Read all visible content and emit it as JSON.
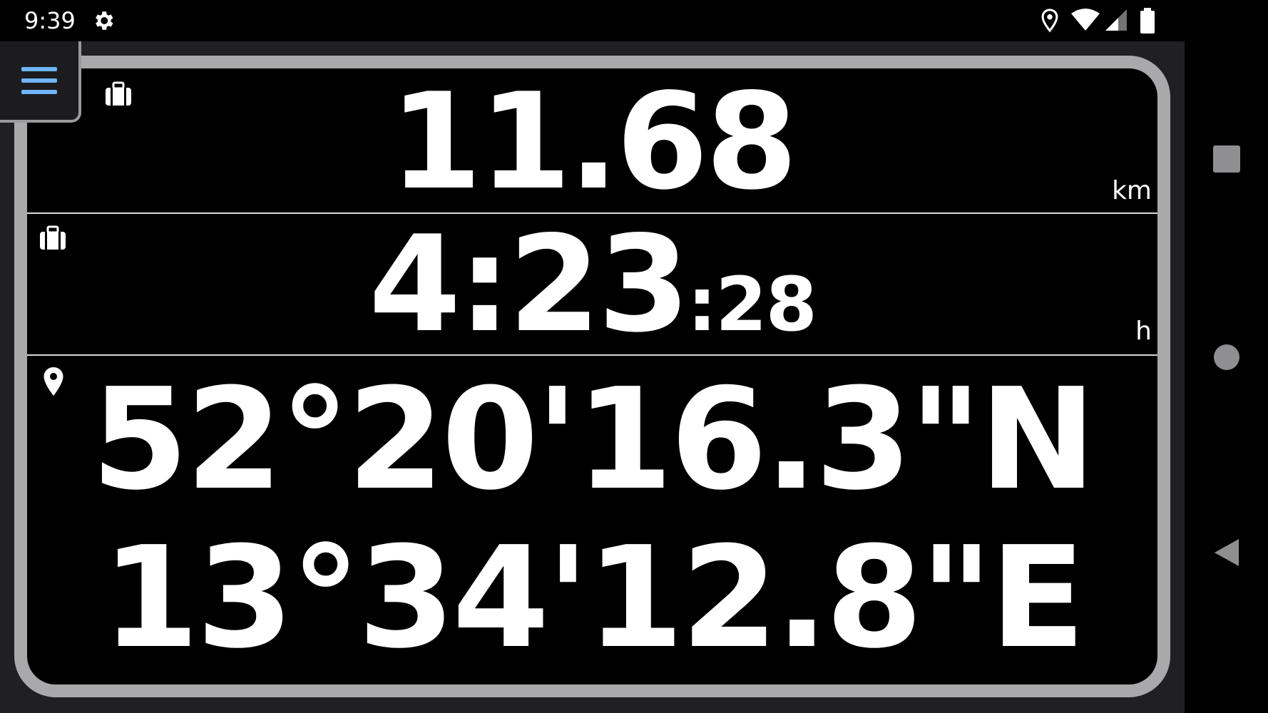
{
  "status_bar": {
    "time": "9:39",
    "icons": [
      "gear-icon",
      "location-icon",
      "wifi-icon",
      "signal-icon",
      "battery-icon"
    ]
  },
  "nav_bar": {
    "icons": [
      "square-icon",
      "circle-icon",
      "back-triangle-icon"
    ]
  },
  "colors": {
    "frame_border": "#a9a9ac",
    "menu_accent": "#6fb5ff",
    "background": "#000000"
  },
  "menu": {
    "icon": "hamburger-menu-icon"
  },
  "rows": {
    "distance": {
      "icon": "briefcase-icon",
      "value": "11.68",
      "unit": "km"
    },
    "time": {
      "icon": "briefcase-icon",
      "hours_minutes": "4:23",
      "seconds": ":28",
      "unit": "h"
    },
    "location": {
      "icon": "location-pin-icon",
      "latitude": "52°20'16.3\"N",
      "longitude": "13°34'12.8\"E"
    }
  }
}
